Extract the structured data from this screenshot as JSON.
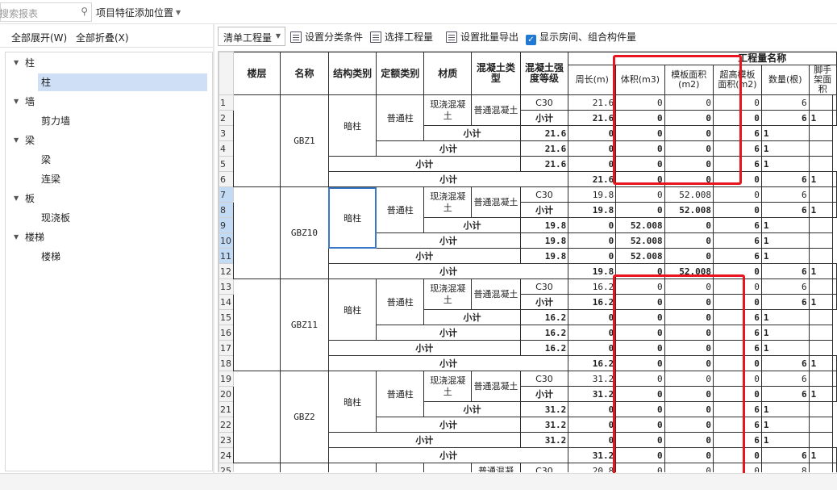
{
  "search": {
    "placeholder": "搜索报表"
  },
  "top": {
    "project_position": "项目特征添加位置"
  },
  "left": {
    "expand_all": "全部展开(W)",
    "collapse_all": "全部折叠(X)",
    "tree": [
      {
        "label": "柱",
        "level": 0
      },
      {
        "label": "柱",
        "level": 1,
        "selected": true
      },
      {
        "label": "墙",
        "level": 0
      },
      {
        "label": "剪力墙",
        "level": 1
      },
      {
        "label": "梁",
        "level": 0
      },
      {
        "label": "梁",
        "level": 1
      },
      {
        "label": "连梁",
        "level": 1
      },
      {
        "label": "板",
        "level": 0
      },
      {
        "label": "现浇板",
        "level": 1
      },
      {
        "label": "楼梯",
        "level": 0
      },
      {
        "label": "楼梯",
        "level": 1
      }
    ]
  },
  "toolbar": {
    "dropdown": "清单工程量",
    "set_category": "设置分类条件",
    "select_quantity": "选择工程量",
    "batch_export": "设置批量导出",
    "show_rooms": "显示房间、组合构件量"
  },
  "headers": {
    "floor": "楼层",
    "name": "名称",
    "struct": "结构类别",
    "quota": "定额类别",
    "material": "材质",
    "concrete_type": "混凝土类型",
    "concrete_grade": "混凝土强度等级",
    "group": "工程量名称",
    "perimeter": "周长(m)",
    "volume": "体积(m3)",
    "formwork": "模板面积(m2)",
    "super_formwork": "超高模板面积(m2)",
    "count": "数量(根)",
    "scaffold": "脚手架面积"
  },
  "labels": {
    "subtotal": "小计",
    "dark_column": "暗柱",
    "normal_column": "普通柱",
    "cast_concrete": "现浇混凝土",
    "normal_concrete": "普通混凝土",
    "c30": "C30"
  },
  "groups": [
    {
      "name": "GBZ1",
      "rows": [
        {
          "perimeter": "21.6",
          "volume": "0",
          "formwork": "0",
          "super": "0",
          "count": "6"
        },
        {
          "perimeter": "21.6",
          "volume": "0",
          "formwork": "0",
          "super": "0",
          "count": "6",
          "scaffold": "1"
        },
        {
          "perimeter": "21.6",
          "volume": "0",
          "formwork": "0",
          "super": "0",
          "count": "6",
          "scaffold": "1"
        },
        {
          "perimeter": "21.6",
          "volume": "0",
          "formwork": "0",
          "super": "0",
          "count": "6",
          "scaffold": "1"
        },
        {
          "perimeter": "21.6",
          "volume": "0",
          "formwork": "0",
          "super": "0",
          "count": "6",
          "scaffold": "1"
        },
        {
          "perimeter": "21.6",
          "volume": "0",
          "formwork": "0",
          "super": "0",
          "count": "6",
          "scaffold": "1"
        }
      ]
    },
    {
      "name": "GBZ10",
      "rows": [
        {
          "perimeter": "19.8",
          "volume": "0",
          "formwork": "52.008",
          "super": "0",
          "count": "6"
        },
        {
          "perimeter": "19.8",
          "volume": "0",
          "formwork": "52.008",
          "super": "0",
          "count": "6",
          "scaffold": "1"
        },
        {
          "perimeter": "19.8",
          "volume": "0",
          "formwork": "52.008",
          "super": "0",
          "count": "6",
          "scaffold": "1"
        },
        {
          "perimeter": "19.8",
          "volume": "0",
          "formwork": "52.008",
          "super": "0",
          "count": "6",
          "scaffold": "1"
        },
        {
          "perimeter": "19.8",
          "volume": "0",
          "formwork": "52.008",
          "super": "0",
          "count": "6",
          "scaffold": "1"
        },
        {
          "perimeter": "19.8",
          "volume": "0",
          "formwork": "52.008",
          "super": "0",
          "count": "6",
          "scaffold": "1"
        }
      ]
    },
    {
      "name": "GBZ11",
      "rows": [
        {
          "perimeter": "16.2",
          "volume": "0",
          "formwork": "0",
          "super": "0",
          "count": "6"
        },
        {
          "perimeter": "16.2",
          "volume": "0",
          "formwork": "0",
          "super": "0",
          "count": "6",
          "scaffold": "1"
        },
        {
          "perimeter": "16.2",
          "volume": "0",
          "formwork": "0",
          "super": "0",
          "count": "6",
          "scaffold": "1"
        },
        {
          "perimeter": "16.2",
          "volume": "0",
          "formwork": "0",
          "super": "0",
          "count": "6",
          "scaffold": "1"
        },
        {
          "perimeter": "16.2",
          "volume": "0",
          "formwork": "0",
          "super": "0",
          "count": "6",
          "scaffold": "1"
        },
        {
          "perimeter": "16.2",
          "volume": "0",
          "formwork": "0",
          "super": "0",
          "count": "6",
          "scaffold": "1"
        }
      ]
    },
    {
      "name": "GBZ2",
      "rows": [
        {
          "perimeter": "31.2",
          "volume": "0",
          "formwork": "0",
          "super": "0",
          "count": "6"
        },
        {
          "perimeter": "31.2",
          "volume": "0",
          "formwork": "0",
          "super": "0",
          "count": "6",
          "scaffold": "1"
        },
        {
          "perimeter": "31.2",
          "volume": "0",
          "formwork": "0",
          "super": "0",
          "count": "6",
          "scaffold": "1"
        },
        {
          "perimeter": "31.2",
          "volume": "0",
          "formwork": "0",
          "super": "0",
          "count": "6",
          "scaffold": "1"
        },
        {
          "perimeter": "31.2",
          "volume": "0",
          "formwork": "0",
          "super": "0",
          "count": "6",
          "scaffold": "1"
        },
        {
          "perimeter": "31.2",
          "volume": "0",
          "formwork": "0",
          "super": "0",
          "count": "6",
          "scaffold": "1"
        }
      ]
    }
  ],
  "partial_row": {
    "row_number": "25",
    "concrete_type": "普通混凝",
    "grade": "C30",
    "perimeter": "20.8",
    "volume": "0",
    "formwork": "0",
    "super": "0",
    "count": "8"
  },
  "row_numbers": [
    "1",
    "2",
    "3",
    "4",
    "5",
    "6",
    "7",
    "8",
    "9",
    "10",
    "11",
    "12",
    "13",
    "14",
    "15",
    "16",
    "17",
    "18",
    "19",
    "20",
    "21",
    "22",
    "23",
    "24"
  ],
  "highlighted_rows": [
    "7",
    "8",
    "9",
    "10",
    "11"
  ],
  "colors": {
    "highlight_box": "#e8141e",
    "selection": "#3b78c8",
    "row_highlight": "#c3daf5"
  }
}
